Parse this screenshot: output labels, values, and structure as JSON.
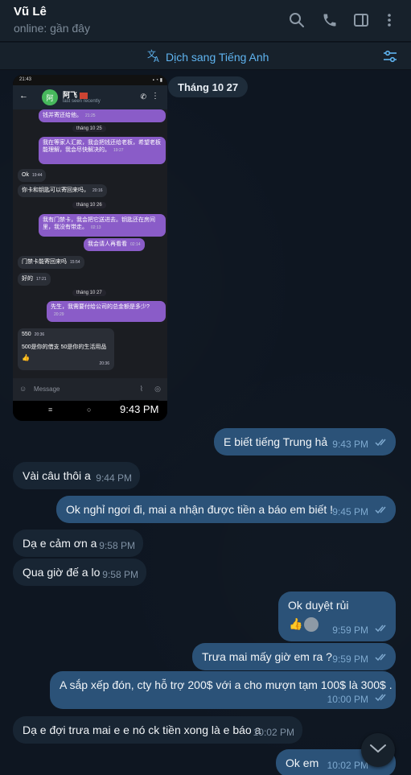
{
  "header": {
    "contact_name": "Vũ Lê",
    "status": "online: gần đây",
    "icons": [
      "search-icon",
      "phone-icon",
      "sidebar-toggle-icon",
      "more-vert-icon"
    ]
  },
  "translate_bar": {
    "label": "Dịch sang Tiếng Anh",
    "icon": "translate-icon",
    "filter_icon": "filter-icon"
  },
  "date_separator": "Tháng 10 27",
  "photo": {
    "status_left": "21:43",
    "contact_initial": "阿",
    "contact_name": "阿飞",
    "last_seen": "last seen recently",
    "input_placeholder": "Message",
    "time_overlay": "9:43 PM",
    "messages": [
      {
        "text": "钱并寄还给他。",
        "time": "21:25",
        "dir": "out"
      },
      {
        "text": "tháng 10 25",
        "type": "date"
      },
      {
        "text": "我在等家人汇款，我会把钱还给老板，希望老板能理解，我会尽快解决的。",
        "time": "19:27",
        "dir": "out"
      },
      {
        "text": "Ok",
        "time": "19:44",
        "dir": "in"
      },
      {
        "text": "你卡和钥匙可以寄回来吗，",
        "time": "20:16",
        "dir": "in"
      },
      {
        "text": "tháng 10 26",
        "type": "date"
      },
      {
        "text": "我有门禁卡，我会把它送进去。钥匙还在房间里，我没有带走。",
        "time": "02:13",
        "dir": "out"
      },
      {
        "text": "我会请人再看看",
        "time": "02:14",
        "dir": "out"
      },
      {
        "text": "门禁卡能寄回来吗",
        "time": "15:54",
        "dir": "in"
      },
      {
        "text": "好的",
        "time": "17:21",
        "dir": "in"
      },
      {
        "text": "tháng 10 27",
        "type": "date"
      },
      {
        "text": "先生，我需要付给公司的总金额是多少?",
        "time": "20:29",
        "dir": "out"
      },
      {
        "text": "550",
        "time": "20:36",
        "dir": "in"
      },
      {
        "text": "500是你的借支 50是你的生活用品",
        "time": "20:36",
        "dir": "in"
      }
    ]
  },
  "messages": [
    {
      "id": "m1",
      "dir": "out",
      "text": "E biết tiếng Trung hả",
      "time": "9:43 PM"
    },
    {
      "id": "m2",
      "dir": "in",
      "text": "Vài câu thôi a",
      "time": "9:44 PM"
    },
    {
      "id": "m3",
      "dir": "out",
      "text": "Ok nghỉ ngơi đi, mai a nhận được tiền a báo em biết !",
      "time": "9:45 PM"
    },
    {
      "id": "m4",
      "dir": "in",
      "text": "Dạ e cảm ơn a",
      "time": "9:58 PM"
    },
    {
      "id": "m5",
      "dir": "in",
      "text": "Qua giờ đế a lo",
      "time": "9:58 PM"
    },
    {
      "id": "m6",
      "dir": "out",
      "text": "Ok duyệt rủi",
      "time": "9:59 PM",
      "reactions": [
        "thumbs-up-icon",
        "avatar"
      ]
    },
    {
      "id": "m7",
      "dir": "out",
      "text": "Trưa mai mấy giờ em ra ?",
      "time": "9:59 PM"
    },
    {
      "id": "m8",
      "dir": "out",
      "text": "A sắp xếp đón, cty hỗ trợ 200$ với a cho mượn tạm 100$ là 300$ .",
      "time": "10:00 PM"
    },
    {
      "id": "m9",
      "dir": "in",
      "text": "Dạ e đợi trưa mai e e nó ck tiền xong là e báo a",
      "time": "10:02 PM"
    },
    {
      "id": "m10",
      "dir": "out",
      "text": "Ok em",
      "time": "10:02 PM"
    }
  ],
  "scroll_button_icon": "chevron-down-icon",
  "colors": {
    "background": "#0e1621",
    "header": "#17212b",
    "incoming": "#182533",
    "outgoing": "#2b5278",
    "accent": "#5fb4f0"
  }
}
